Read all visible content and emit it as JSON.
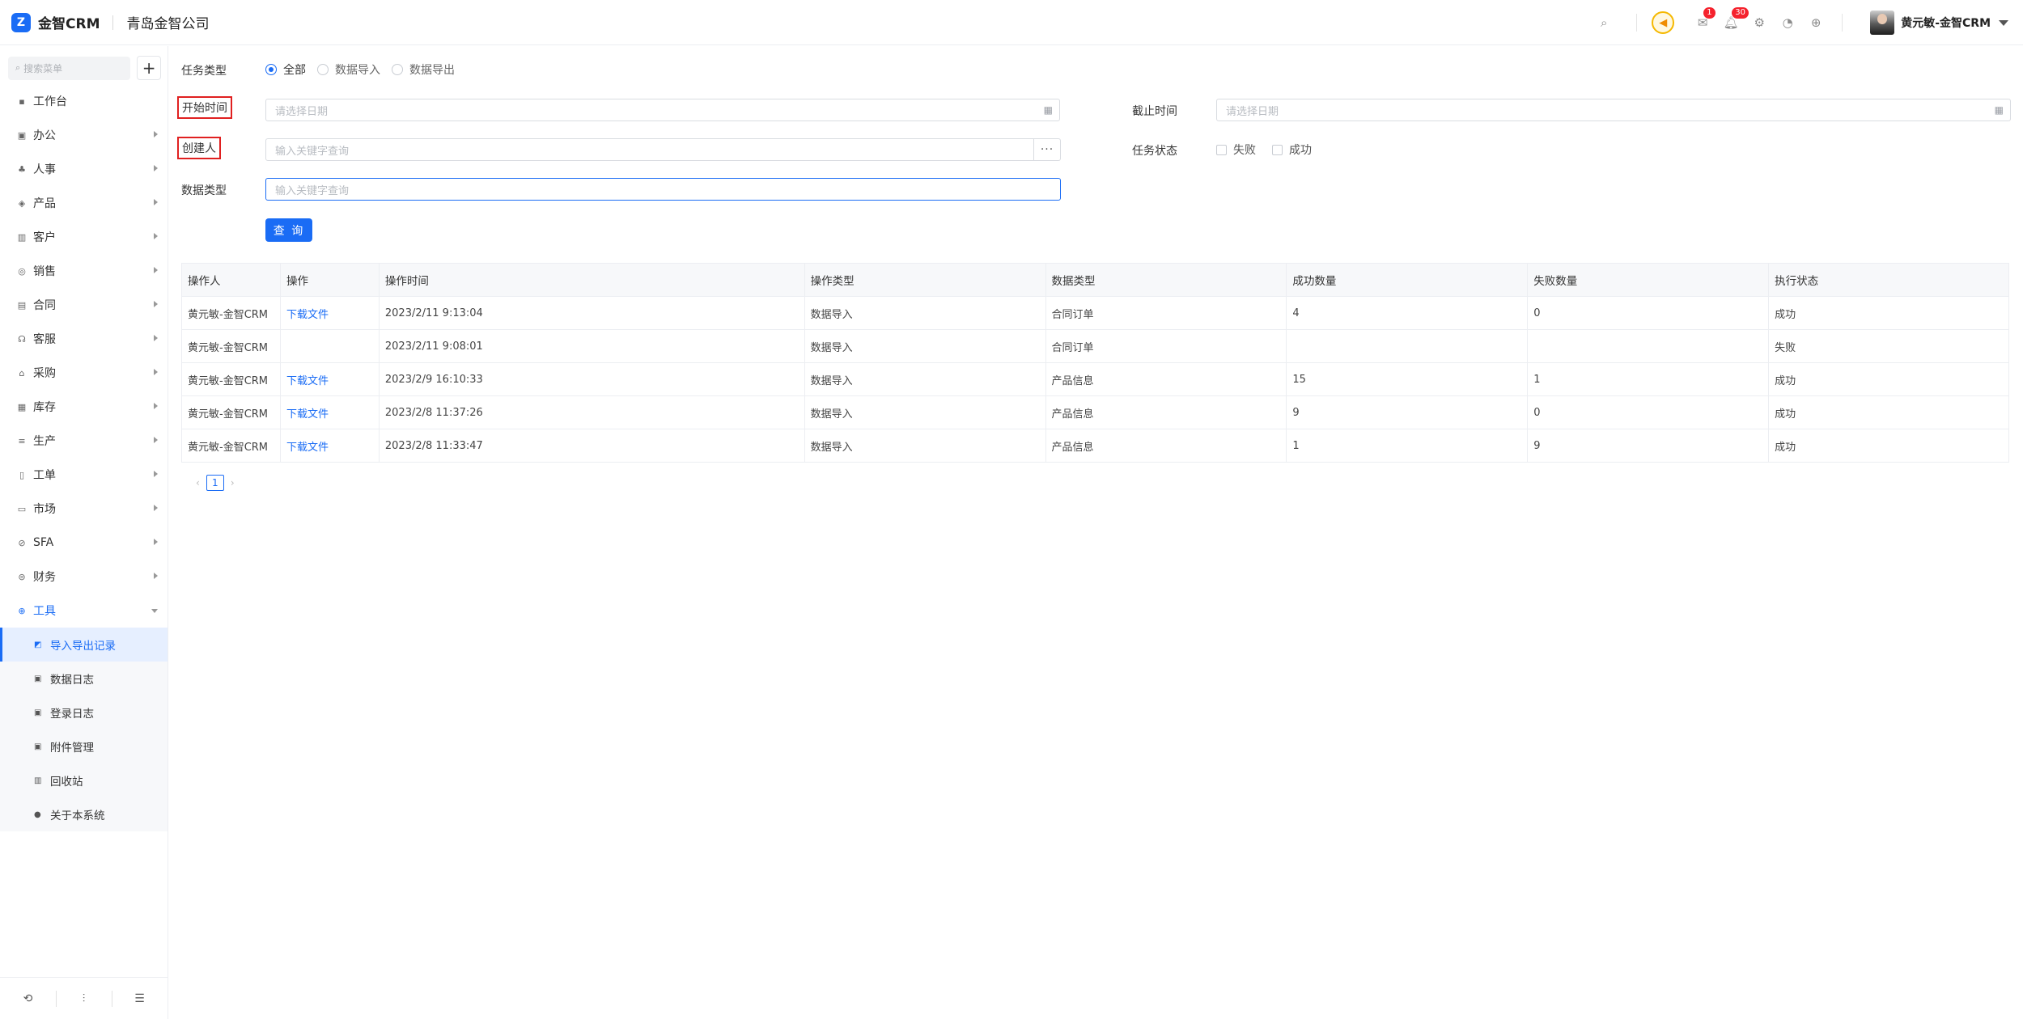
{
  "header": {
    "logo_mark": "Z",
    "app_name": "金智CRM",
    "company": "青岛金智公司",
    "badges": {
      "messages": "1",
      "notifications": "30"
    },
    "user_name": "黄元敏-金智CRM"
  },
  "sidebar": {
    "search_placeholder": "搜索菜单",
    "add_label": "+",
    "items": [
      {
        "label": "工作台",
        "icon": "dashboard-icon",
        "has_children": false
      },
      {
        "label": "办公",
        "icon": "office-icon",
        "has_children": true
      },
      {
        "label": "人事",
        "icon": "people-icon",
        "has_children": true
      },
      {
        "label": "产品",
        "icon": "product-icon",
        "has_children": true
      },
      {
        "label": "客户",
        "icon": "customer-icon",
        "has_children": true
      },
      {
        "label": "销售",
        "icon": "sales-icon",
        "has_children": true
      },
      {
        "label": "合同",
        "icon": "contract-icon",
        "has_children": true
      },
      {
        "label": "客服",
        "icon": "support-icon",
        "has_children": true
      },
      {
        "label": "采购",
        "icon": "purchase-icon",
        "has_children": true
      },
      {
        "label": "库存",
        "icon": "inventory-icon",
        "has_children": true
      },
      {
        "label": "生产",
        "icon": "production-icon",
        "has_children": true
      },
      {
        "label": "工单",
        "icon": "ticket-icon",
        "has_children": true
      },
      {
        "label": "市场",
        "icon": "market-icon",
        "has_children": true
      },
      {
        "label": "SFA",
        "icon": "sfa-icon",
        "has_children": true
      },
      {
        "label": "财务",
        "icon": "finance-icon",
        "has_children": true
      },
      {
        "label": "工具",
        "icon": "tools-icon",
        "has_children": true,
        "open": true
      }
    ],
    "tools_children": [
      {
        "label": "导入导出记录",
        "icon": "import-export-icon",
        "active": true
      },
      {
        "label": "数据日志",
        "icon": "data-log-icon"
      },
      {
        "label": "登录日志",
        "icon": "login-log-icon"
      },
      {
        "label": "附件管理",
        "icon": "attachment-icon"
      },
      {
        "label": "回收站",
        "icon": "recycle-bin-icon"
      },
      {
        "label": "关于本系统",
        "icon": "info-icon"
      }
    ]
  },
  "filters": {
    "task_type_label": "任务类型",
    "task_type_options": [
      "全部",
      "数据导入",
      "数据导出"
    ],
    "task_type_selected": "全部",
    "start_time_label": "开始时间",
    "start_time_placeholder": "请选择日期",
    "end_time_label": "截止时间",
    "end_time_placeholder": "请选择日期",
    "creator_label": "创建人",
    "creator_placeholder": "输入关键字查询",
    "task_status_label": "任务状态",
    "task_status_options": [
      "失败",
      "成功"
    ],
    "data_type_label": "数据类型",
    "data_type_placeholder": "输入关键字查询",
    "query_button": "查 询"
  },
  "table": {
    "columns": [
      "操作人",
      "操作",
      "操作时间",
      "操作类型",
      "数据类型",
      "成功数量",
      "失败数量",
      "执行状态"
    ],
    "rows": [
      [
        "黄元敏-金智CRM",
        "下载文件",
        "2023/2/11 9:13:04",
        "数据导入",
        "合同订单",
        "4",
        "0",
        "成功"
      ],
      [
        "黄元敏-金智CRM",
        "",
        "2023/2/11 9:08:01",
        "数据导入",
        "合同订单",
        "",
        "",
        "失败"
      ],
      [
        "黄元敏-金智CRM",
        "下载文件",
        "2023/2/9 16:10:33",
        "数据导入",
        "产品信息",
        "15",
        "1",
        "成功"
      ],
      [
        "黄元敏-金智CRM",
        "下载文件",
        "2023/2/8 11:37:26",
        "数据导入",
        "产品信息",
        "9",
        "0",
        "成功"
      ],
      [
        "黄元敏-金智CRM",
        "下载文件",
        "2023/2/8 11:33:47",
        "数据导入",
        "产品信息",
        "1",
        "9",
        "成功"
      ]
    ]
  },
  "pagination": {
    "prev": "‹",
    "current": "1",
    "next": "›"
  },
  "colors": {
    "accent": "#1a6cf5",
    "highlight_border": "#e02020",
    "badge": "#f5222d"
  }
}
